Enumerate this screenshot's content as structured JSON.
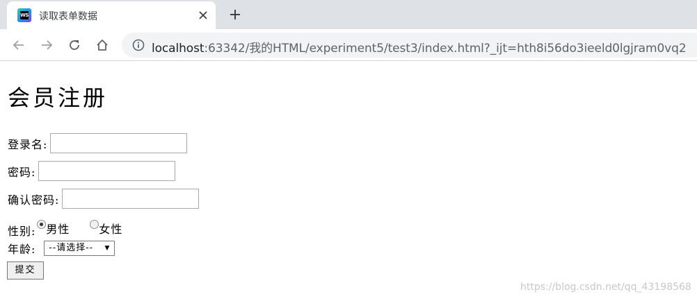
{
  "browser": {
    "tab": {
      "favicon_text": "WS",
      "title": "读取表单数据",
      "close_icon": "close-icon"
    },
    "newtab_icon": "plus-icon",
    "nav": {
      "back_icon": "arrow-left-icon",
      "forward_icon": "arrow-right-icon",
      "reload_icon": "reload-icon",
      "home_icon": "home-icon"
    },
    "address": {
      "info_icon": "info-icon",
      "host": "localhost",
      "rest": ":63342/我的HTML/experiment5/test3/index.html?_ijt=hth8i56do3ieeld0lgjram0vq2"
    }
  },
  "form": {
    "title": "会员注册",
    "login_label": "登录名:",
    "login_value": "",
    "password_label": "密码:",
    "password_value": "",
    "confirm_label": "确认密码:",
    "confirm_value": "",
    "gender_label": "性别:",
    "gender_male": "男性",
    "gender_female": "女性",
    "gender_selected": "male",
    "age_label": "年龄:",
    "age_selected": "--请选择--",
    "submit_label": "提交"
  },
  "watermark": "https://blog.csdn.net/qq_43198568",
  "colors": {
    "tabstrip_bg": "#dee1e6",
    "omnibox_bg": "#f1f3f4",
    "icon": "#5f6368"
  }
}
